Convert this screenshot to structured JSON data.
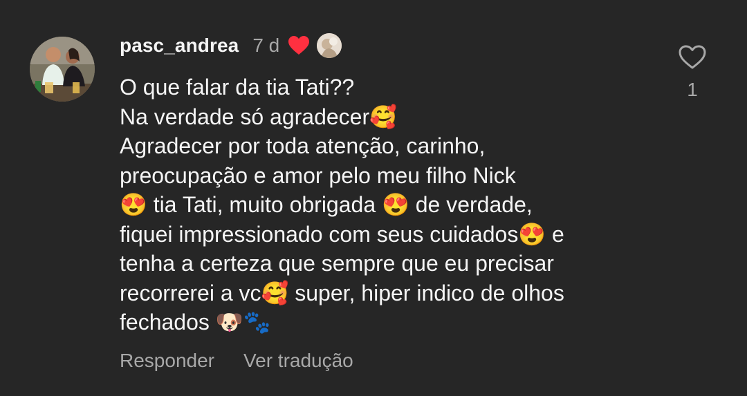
{
  "comment": {
    "username": "pasc_andrea",
    "time": "7 d",
    "lines": [
      "O que falar da tia Tati??",
      "Na verdade só agradecer🥰",
      "Agradecer por toda atenção, carinho,",
      "preocupação e amor pelo meu filho Nick",
      "😍 tia Tati, muito obrigada 😍 de verdade,",
      "fiquei impressionado com seus cuidados😍 e",
      "tenha a certeza que sempre que eu precisar",
      "recorrerei a vc🥰 super, hiper indico de olhos",
      "fechados 🐶🐾"
    ]
  },
  "actions": {
    "reply": "Responder",
    "translate": "Ver tradução"
  },
  "like": {
    "count": "1"
  },
  "icons": {
    "author_heart": "red-heart-icon",
    "like_button": "heart-outline-icon"
  },
  "colors": {
    "background": "#262626",
    "primary_text": "#f5f5f5",
    "secondary_text": "#a8a8a8",
    "heart_red": "#ff3040"
  }
}
